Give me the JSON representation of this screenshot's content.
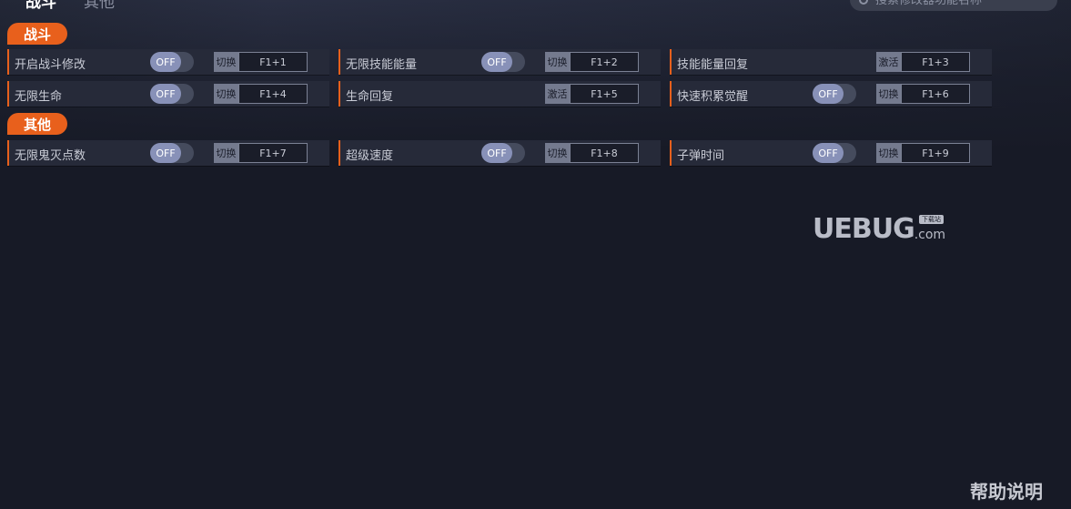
{
  "tabs": [
    {
      "label": "战斗",
      "active": true
    },
    {
      "label": "其他",
      "active": false
    }
  ],
  "search": {
    "placeholder": "搜索修改器功能名称"
  },
  "sections": [
    {
      "title": "战斗"
    },
    {
      "title": "其他"
    }
  ],
  "cheats": [
    {
      "label": "开启战斗修改",
      "toggle": "OFF",
      "mode": "切换",
      "hotkey": "F1+1"
    },
    {
      "label": "无限技能能量",
      "toggle": "OFF",
      "mode": "切换",
      "hotkey": "F1+2"
    },
    {
      "label": "技能能量回复",
      "toggle": null,
      "mode": "激活",
      "hotkey": "F1+3"
    },
    {
      "label": "无限生命",
      "toggle": "OFF",
      "mode": "切换",
      "hotkey": "F1+4"
    },
    {
      "label": "生命回复",
      "toggle": null,
      "mode": "激活",
      "hotkey": "F1+5"
    },
    {
      "label": "快速积累觉醒",
      "toggle": "OFF",
      "mode": "切换",
      "hotkey": "F1+6"
    },
    {
      "label": "无限鬼灭点数",
      "toggle": "OFF",
      "mode": "切换",
      "hotkey": "F1+7"
    },
    {
      "label": "超级速度",
      "toggle": "OFF",
      "mode": "切换",
      "hotkey": "F1+8"
    },
    {
      "label": "子弹时间",
      "toggle": "OFF",
      "mode": "切换",
      "hotkey": "F1+9"
    }
  ],
  "brand": {
    "main": "UEBUG",
    "suffix": ".com",
    "badge": "下载站"
  },
  "help": {
    "label": "帮助说明"
  },
  "colors": {
    "accent": "#e8601c",
    "background": "#171a26",
    "cell": "#262a39",
    "toggle_knob": "#8891b8"
  }
}
